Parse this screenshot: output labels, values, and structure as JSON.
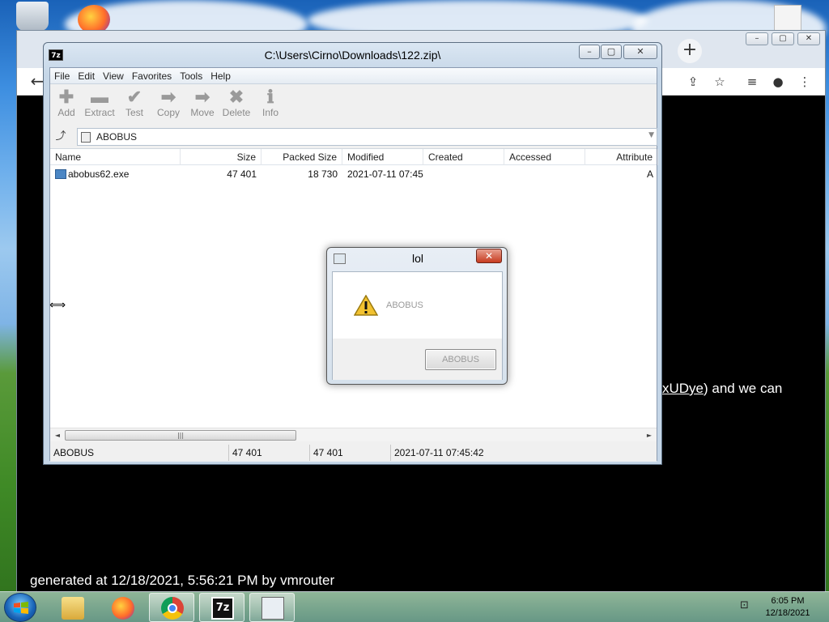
{
  "zip_window": {
    "title": "C:\\Users\\Cirno\\Downloads\\122.zip\\",
    "logo": "7z",
    "menu": [
      "File",
      "Edit",
      "View",
      "Favorites",
      "Tools",
      "Help"
    ],
    "toolbar": [
      {
        "label": "Add",
        "icon": "plus-icon"
      },
      {
        "label": "Extract",
        "icon": "minus-icon"
      },
      {
        "label": "Test",
        "icon": "check-icon"
      },
      {
        "label": "Copy",
        "icon": "arrow-right-icon"
      },
      {
        "label": "Move",
        "icon": "arrow-right-icon"
      },
      {
        "label": "Delete",
        "icon": "x-icon"
      },
      {
        "label": "Info",
        "icon": "info-icon"
      }
    ],
    "path": "ABOBUS",
    "columns": [
      "Name",
      "Size",
      "Packed Size",
      "Modified",
      "Created",
      "Accessed",
      "Attribute"
    ],
    "files": [
      {
        "name": "abobus62.exe",
        "size": "47 401",
        "packed": "18 730",
        "modified": "2021-07-11 07:45",
        "created": "",
        "accessed": "",
        "attr": "A"
      }
    ],
    "status": {
      "selection": "ABOBUS",
      "size": "47 401",
      "packed": "47 401",
      "modified": "2021-07-11 07:45:42"
    }
  },
  "dialog": {
    "title": "lol",
    "message": "ABOBUS",
    "button": "ABOBUS",
    "close": "✕"
  },
  "browser": {
    "text_prefix": "xUDye",
    "text_suffix": ") and we can",
    "footer": "generated at 12/18/2021, 5:56:21 PM by vmrouter"
  },
  "taskbar": {
    "apps": [
      "explorer",
      "firefox",
      "chrome",
      "7-zip",
      "dialog"
    ],
    "time": "6:05 PM",
    "date": "12/18/2021"
  }
}
